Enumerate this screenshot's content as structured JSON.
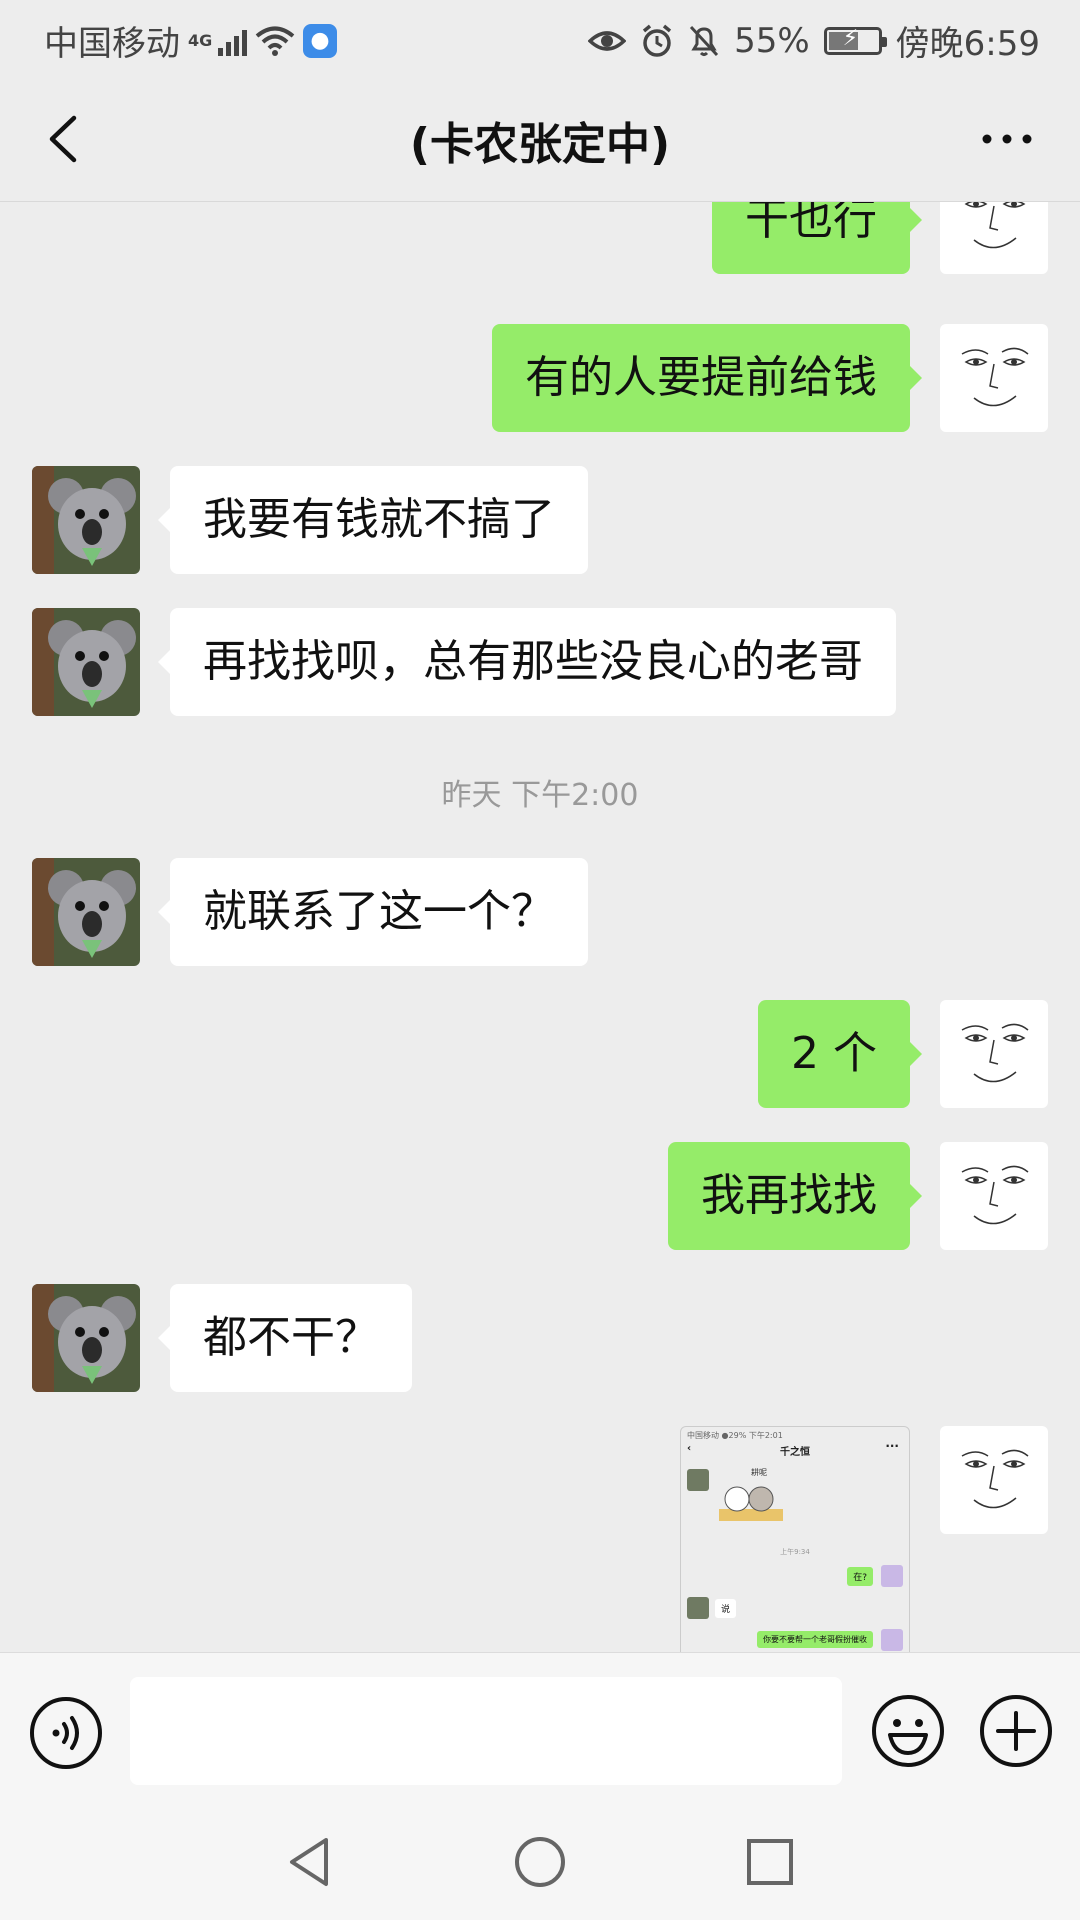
{
  "status_bar": {
    "carrier": "中国移动",
    "network": "4G",
    "battery_percent": "55%",
    "battery_level": 0.55,
    "time": "傍晚6:59"
  },
  "header": {
    "title": "(卡农张定中)"
  },
  "messages": [
    {
      "side": "out",
      "text": "干也行"
    },
    {
      "side": "out",
      "text": "有的人要提前给钱"
    },
    {
      "side": "in",
      "text": "我要有钱就不搞了"
    },
    {
      "side": "in",
      "text": "再找找呗，总有那些没良心的老哥"
    },
    {
      "side": "in",
      "text": "就联系了这一个？"
    },
    {
      "side": "out",
      "text": "2 个"
    },
    {
      "side": "out",
      "text": "我再找找"
    },
    {
      "side": "in",
      "text": "都不干？"
    }
  ],
  "timestamp": "昨天 下午2:00",
  "screenshot_message": {
    "status": "中国移动  ●29% 下午2:01",
    "title": "千之恒",
    "sticker_text": "耕呢",
    "time": "上午9:34",
    "bubble_1": "在?",
    "bubble_2": "说",
    "bubble_3": "你要不要帮一个老哥假扮催收"
  },
  "input_bar": {
    "placeholder": "",
    "icons": [
      "voice-icon",
      "emoji-icon",
      "plus-icon"
    ]
  },
  "system_nav": [
    "back-triangle-icon",
    "home-circle-icon",
    "recents-square-icon"
  ],
  "colors": {
    "background": "#ededed",
    "outgoing_bubble": "#95ec69",
    "incoming_bubble": "#ffffff"
  }
}
